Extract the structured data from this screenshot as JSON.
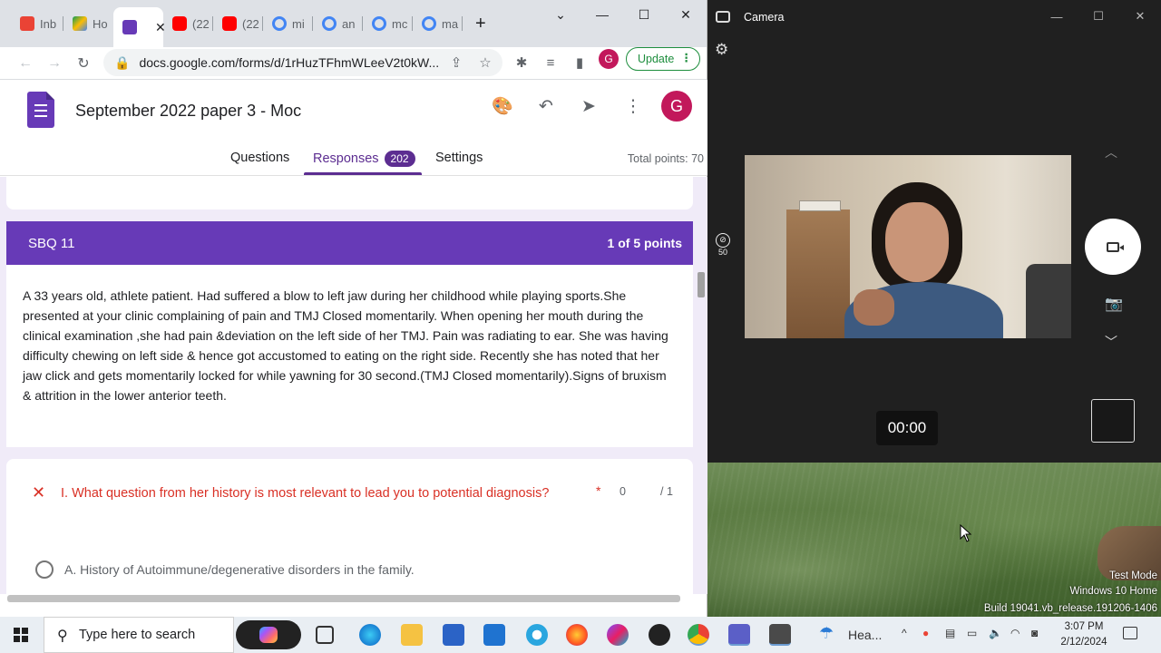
{
  "browser": {
    "tabs": [
      {
        "label": "Inb",
        "icon": "gmail-icon",
        "color": "#ea4335"
      },
      {
        "label": "Ho",
        "icon": "google-drive-icon",
        "color": "#fbbc04"
      },
      {
        "label": "",
        "icon": "google-forms-icon",
        "color": "#673ab7",
        "active": true
      },
      {
        "label": "(22",
        "icon": "youtube-icon",
        "color": "#ff0000"
      },
      {
        "label": "(22",
        "icon": "youtube-icon",
        "color": "#ff0000"
      },
      {
        "label": "mi",
        "icon": "google-icon",
        "color": "#4285f4"
      },
      {
        "label": "an",
        "icon": "google-icon",
        "color": "#4285f4"
      },
      {
        "label": "mc",
        "icon": "google-icon",
        "color": "#4285f4"
      },
      {
        "label": "ma",
        "icon": "google-icon",
        "color": "#4285f4"
      }
    ],
    "url": "docs.google.com/forms/d/1rHuzTFhmWLeeV2t0kW...",
    "profile_initial": "G",
    "update_label": "Update"
  },
  "form": {
    "title": "September 2022 paper 3 - Moc",
    "avatar_initial": "G",
    "tabs": {
      "questions": "Questions",
      "responses": "Responses",
      "responses_count": "202",
      "settings": "Settings"
    },
    "total_points": "Total points: 70",
    "section": {
      "title": "SBQ 11",
      "points": "1 of 5 points",
      "description": "A 33 years old, athlete patient. Had suffered a blow to left jaw during her childhood while playing sports.She presented at your clinic complaining of pain and TMJ Closed momentarily. When opening her mouth during the clinical examination ,she had pain &deviation on the left side of her TMJ. Pain was radiating to ear. She was having difficulty chewing on left side & hence got accustomed to eating on the right side. Recently she has noted that her jaw click and gets momentarily locked for while yawning for 30 second.(TMJ Closed momentarily).Signs of bruxism & attrition in the lower anterior teeth."
    },
    "question": {
      "text": "I. What question from her history is most relevant to lead you to potential diagnosis?",
      "required_mark": "*",
      "score": "0",
      "max": "/ 1",
      "option_a": "A. History of Autoimmune/degenerative disorders in the family."
    }
  },
  "camera": {
    "title": "Camera",
    "ratio_label": "50",
    "timer": "00:00"
  },
  "desktop": {
    "watermark_line1": "Test Mode",
    "watermark_line2": "Windows 10 Home",
    "watermark_line3": "Build 19041.vb_release.191206-1406"
  },
  "taskbar": {
    "search_placeholder": "Type here to search",
    "weather_label": "Hea...",
    "time": "3:07 PM",
    "date": "2/12/2024"
  },
  "colors": {
    "forms_purple": "#673ab7",
    "responses_accent": "#5c2d91",
    "error_red": "#d93025",
    "update_green": "#1e8e3e"
  }
}
